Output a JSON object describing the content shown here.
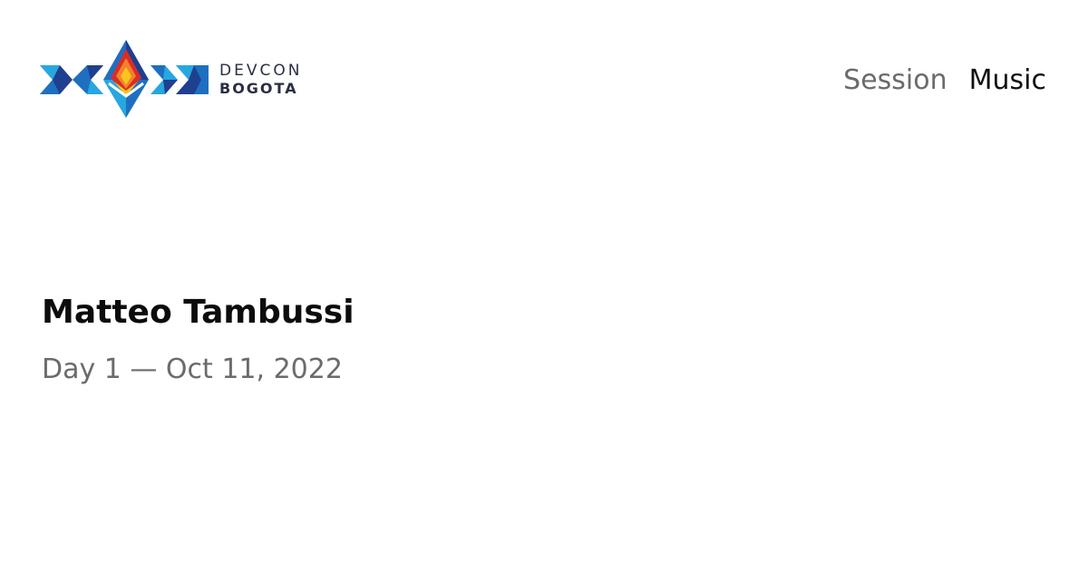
{
  "logo": {
    "line1": "DEVCON",
    "line2": "BOGOTA",
    "colors": {
      "dark_blue": "#1f3f8f",
      "mid_blue": "#1f6fc0",
      "light_blue": "#27a7e0",
      "red": "#d92d27",
      "orange": "#f0832a",
      "yellow": "#f9c51c",
      "text": "#2a2e45"
    }
  },
  "tags": {
    "session": "Session",
    "music": "Music"
  },
  "title": "Matteo Tambussi",
  "date": "Day 1 — Oct 11, 2022",
  "colors": {
    "background": "#ffffff",
    "title": "#0c0c0c",
    "muted": "#6b6b6b"
  }
}
